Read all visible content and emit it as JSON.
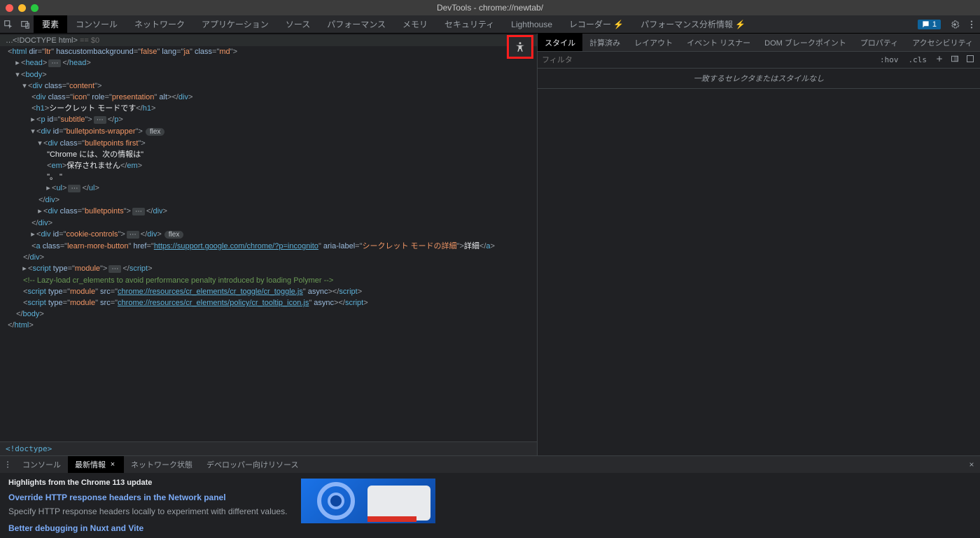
{
  "window": {
    "title": "DevTools - chrome://newtab/"
  },
  "mainTabs": {
    "items": [
      "要素",
      "コンソール",
      "ネットワーク",
      "アプリケーション",
      "ソース",
      "パフォーマンス",
      "メモリ",
      "セキュリティ",
      "Lighthouse",
      "レコーダー ⚡",
      "パフォーマンス分析情報 ⚡"
    ],
    "activeIndex": 0,
    "issuesBadge": "1"
  },
  "dom": {
    "doctype": "<!DOCTYPE html>",
    "eqDollar": "== $0",
    "htmlOpen": {
      "tag": "html",
      "attrs": [
        [
          "dir",
          "ltr"
        ],
        [
          "hascustombackground",
          "false"
        ],
        [
          "lang",
          "ja"
        ],
        [
          "class",
          "md"
        ]
      ]
    },
    "headLine": {
      "open": "head",
      "close": "head"
    },
    "divContent": {
      "tag": "div",
      "attrs": [
        [
          "class",
          "content"
        ]
      ]
    },
    "divIcon": {
      "tag": "div",
      "attrs": [
        [
          "class",
          "icon"
        ],
        [
          "role",
          "presentation"
        ],
        [
          "alt",
          ""
        ]
      ]
    },
    "h1Text": "シークレット モードです",
    "pSubtitle": {
      "tag": "p",
      "attrs": [
        [
          "id",
          "subtitle"
        ]
      ]
    },
    "bulletWrapper": {
      "tag": "div",
      "attrs": [
        [
          "id",
          "bulletpoints-wrapper"
        ]
      ],
      "badge": "flex"
    },
    "bulletFirst": {
      "tag": "div",
      "attrs": [
        [
          "class",
          "bulletpoints first"
        ]
      ]
    },
    "chromeInfoText": "\"Chrome には、次の情報は\"",
    "emText": "保存されません",
    "quoteDots": "\"。 \"",
    "bulletSecond": {
      "tag": "div",
      "attrs": [
        [
          "class",
          "bulletpoints"
        ]
      ]
    },
    "cookieControls": {
      "tag": "div",
      "attrs": [
        [
          "id",
          "cookie-controls"
        ]
      ],
      "badge": "flex"
    },
    "learnMore": {
      "tag": "a",
      "attrs": [
        [
          "class",
          "learn-more-button"
        ],
        [
          "href",
          "https://support.google.com/chrome/?p=incognito"
        ],
        [
          "aria-label",
          "シークレット モードの詳細"
        ]
      ],
      "text": "詳細"
    },
    "scriptModule": {
      "tag": "script",
      "attrs": [
        [
          "type",
          "module"
        ]
      ]
    },
    "lazyComment": "<!-- Lazy-load cr_elements to avoid performance penalty introduced by loading Polymer -->",
    "script1": {
      "attrs": [
        [
          "type",
          "module"
        ],
        [
          "src",
          "chrome://resources/cr_elements/cr_toggle/cr_toggle.js"
        ],
        [
          "async",
          ""
        ]
      ]
    },
    "script2": {
      "attrs": [
        [
          "type",
          "module"
        ],
        [
          "src",
          "chrome://resources/cr_elements/policy/cr_tooltip_icon.js"
        ],
        [
          "async",
          ""
        ]
      ]
    }
  },
  "breadcrumb": "<!doctype>",
  "styles": {
    "tabs": [
      "スタイル",
      "計算済み",
      "レイアウト",
      "イベント リスナー",
      "DOM ブレークポイント",
      "プロパティ",
      "アクセシビリティ"
    ],
    "activeIndex": 0,
    "filterPlaceholder": "フィルタ",
    "hov": ":hov",
    "cls": ".cls",
    "noMatch": "一致するセレクタまたはスタイルなし"
  },
  "drawer": {
    "tabs": [
      "コンソール",
      "最新情報",
      "ネットワーク状態",
      "デベロッパー向けリソース"
    ],
    "activeIndex": 1,
    "heading": "Highlights from the Chrome 113 update",
    "item1": {
      "title": "Override HTTP response headers in the Network panel",
      "desc": "Specify HTTP response headers locally to experiment with different values."
    },
    "item2": {
      "title": "Better debugging in Nuxt and Vite"
    }
  }
}
